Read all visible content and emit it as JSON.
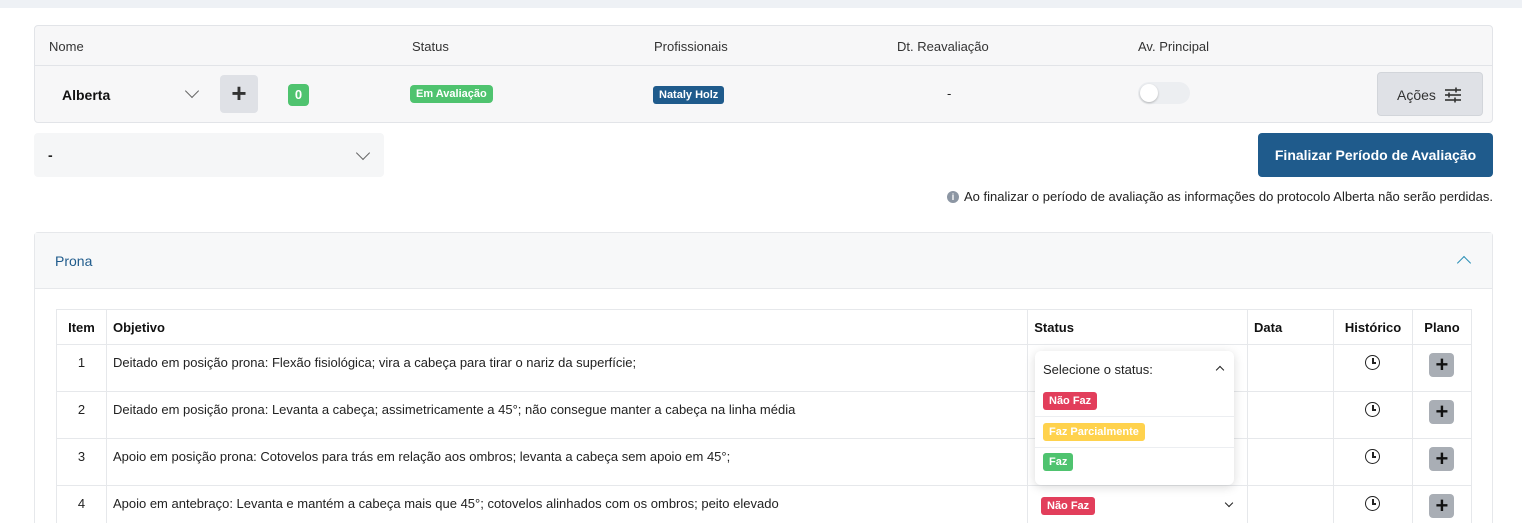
{
  "summary": {
    "headers": {
      "name": "Nome",
      "status": "Status",
      "professionals": "Profissionais",
      "reevaluation_date": "Dt. Reavaliação",
      "main_evaluation": "Av. Principal"
    },
    "protocol_name": "Alberta",
    "add_label": "+",
    "count": "0",
    "status": "Em Avaliação",
    "professional": "Nataly Holz",
    "reevaluation_date": "-",
    "main_evaluation_on": false,
    "actions_label": "Ações"
  },
  "period": {
    "selected": "-"
  },
  "finalize_button": "Finalizar Período de Avaliação",
  "info_message": "Ao finalizar o período de avaliação as informações do protocolo Alberta não serão perdidas.",
  "info_icon_glyph": "i",
  "section": {
    "title": "Prona",
    "expanded": true,
    "columns": {
      "item": "Item",
      "objective": "Objetivo",
      "status": "Status",
      "date": "Data",
      "history": "Histórico",
      "plan": "Plano"
    },
    "rows": [
      {
        "item": "1",
        "objective": "Deitado em posição prona: Flexão fisiológica; vira a cabeça para tirar o nariz da superfície;"
      },
      {
        "item": "2",
        "objective": "Deitado em posição prona: Levanta a cabeça; assimetricamente a 45°; não consegue manter a cabeça na linha média"
      },
      {
        "item": "3",
        "objective": "Apoio em posição prona: Cotovelos para trás em relação aos ombros; levanta a cabeça sem apoio em 45°;"
      },
      {
        "item": "4",
        "objective": "Apoio em antebraço: Levanta e mantém a cabeça mais que 45°; cotovelos alinhados com os ombros; peito elevado"
      }
    ],
    "plan_label": "+",
    "status_dropdown": {
      "placeholder": "Selecione o status:",
      "options": [
        "Não Faz",
        "Faz Parcialmente",
        "Faz"
      ]
    },
    "row4_status": "Não Faz"
  },
  "colors": {
    "primary": "#1f5b8c",
    "success": "#4fc36f",
    "danger": "#e23e5b",
    "warning": "#ffd24d"
  }
}
